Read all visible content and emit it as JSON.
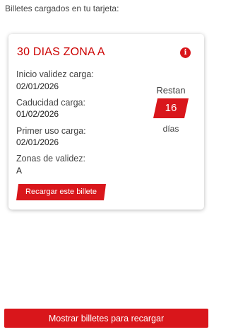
{
  "header": {
    "section_title": "Billetes cargados en tu tarjeta:"
  },
  "ticket": {
    "title": "30 DIAS ZONA A",
    "info_icon": "info-icon",
    "info_glyph": "i",
    "fields": [
      {
        "label": "Inicio validez carga:",
        "value": "02/01/2026"
      },
      {
        "label": "Caducidad carga:",
        "value": "01/02/2026"
      },
      {
        "label": "Primer uso carga:",
        "value": "02/01/2026"
      },
      {
        "label": "Zonas de validez:",
        "value": "A"
      }
    ],
    "remaining": {
      "label_top": "Restan",
      "count": "16",
      "label_bottom": "días"
    },
    "recharge_button_label": "Recargar este billete"
  },
  "footer": {
    "show_tickets_button_label": "Mostrar billetes para recargar"
  },
  "colors": {
    "accent": "#d9161b",
    "title_red": "#cc0000",
    "text": "#444444"
  }
}
